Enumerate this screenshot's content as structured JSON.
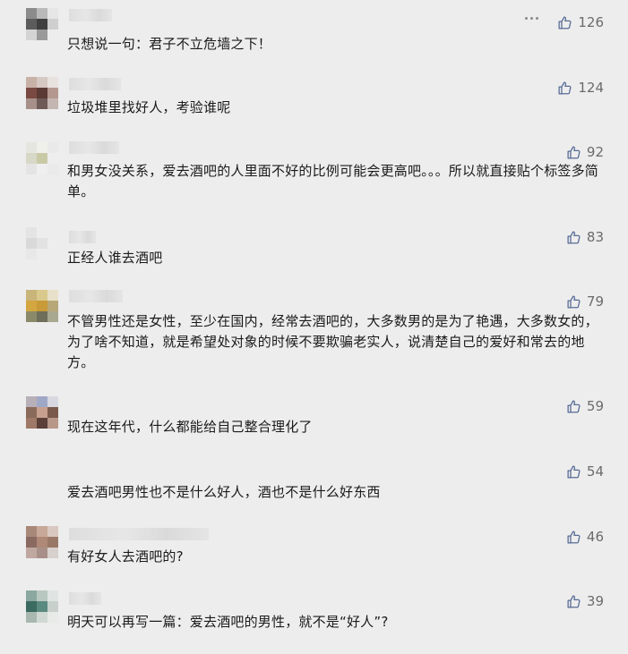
{
  "comments": [
    {
      "text": "只想说一句：君子不立危墙之下！",
      "likes": "126",
      "avatar_colors": [
        "#8b8b8b",
        "#b9b9b9",
        "#e6e6e6",
        "#5c5c5c",
        "#3f3f3f",
        "#cfcfcf",
        "#d4d4d4",
        "#9a9a9a",
        "#ededed"
      ],
      "icon": "thumbs-up-icon"
    },
    {
      "text": "垃圾堆里找好人，考验谁呢",
      "likes": "124",
      "avatar_colors": [
        "#c8b2a8",
        "#d6c8c2",
        "#e8e2de",
        "#7a4a42",
        "#5a3a34",
        "#b49890",
        "#a8908a",
        "#6e5a56",
        "#c4b6b0"
      ]
    },
    {
      "text": "和男女没关系，爱去酒吧的人里面不好的比例可能会更高吧。。。所以就直接贴个标签多简单。",
      "likes": "92",
      "avatar_colors": [
        "#e6e6e0",
        "#f0f0ea",
        "#e9e9e9",
        "#d8d8c8",
        "#c9c9a6",
        "#eeeeee",
        "#e4e4e4",
        "#efefef",
        "#eaeaea"
      ]
    },
    {
      "text": "正经人谁去酒吧",
      "likes": "83",
      "avatar_colors": [
        "#e4e4e4",
        "#ededed",
        "#ededed",
        "#d9d9d9",
        "#e2e2e2",
        "#ededed",
        "#e8e8e8",
        "#ededed",
        "#ededed"
      ]
    },
    {
      "text": "不管男性还是女性，至少在国内，经常去酒吧的，大多数男的是为了艳遇，大多数女的，为了啥不知道，就是希望处对象的时候不要欺骗老实人，说清楚自己的爱好和常去的地方。",
      "likes": "79",
      "avatar_colors": [
        "#c9b47a",
        "#d9c98c",
        "#e8e0c8",
        "#d4a640",
        "#c89a38",
        "#b8a878",
        "#8a8a6a",
        "#6e6e5a",
        "#a8a890"
      ]
    },
    {
      "text": "现在这年代，什么都能给自己整合理化了",
      "likes": "59",
      "avatar_colors": [
        "#b8b0b8",
        "#a0a8c8",
        "#d8d8e0",
        "#8a6a5a",
        "#c8a090",
        "#7a5a4a",
        "#a07868",
        "#5a4038",
        "#b89888"
      ]
    },
    {
      "text": "爱去酒吧男性也不是什么好人，酒也不是什么好东西",
      "likes": "54",
      "avatar_colors": [
        "#ededed",
        "#ededed",
        "#ededed",
        "#ededed",
        "#ededed",
        "#ededed",
        "#ededed",
        "#ededed",
        "#ededed"
      ]
    },
    {
      "text": "有好女人去酒吧的?",
      "likes": "46",
      "avatar_colors": [
        "#a88878",
        "#c8a898",
        "#d8c8c0",
        "#8a6a60",
        "#b08878",
        "#9a7868",
        "#c0a8a0",
        "#a89088",
        "#d8d0cc"
      ]
    },
    {
      "text": "明天可以再写一篇：爱去酒吧的男性，就不是“好人”?",
      "likes": "39",
      "avatar_colors": [
        "#8aa8a0",
        "#b8c8c0",
        "#e0e4e2",
        "#3a6a60",
        "#5a8a80",
        "#c8d0cc",
        "#a8b8b0",
        "#d0d8d4",
        "#e8eae8"
      ]
    }
  ]
}
